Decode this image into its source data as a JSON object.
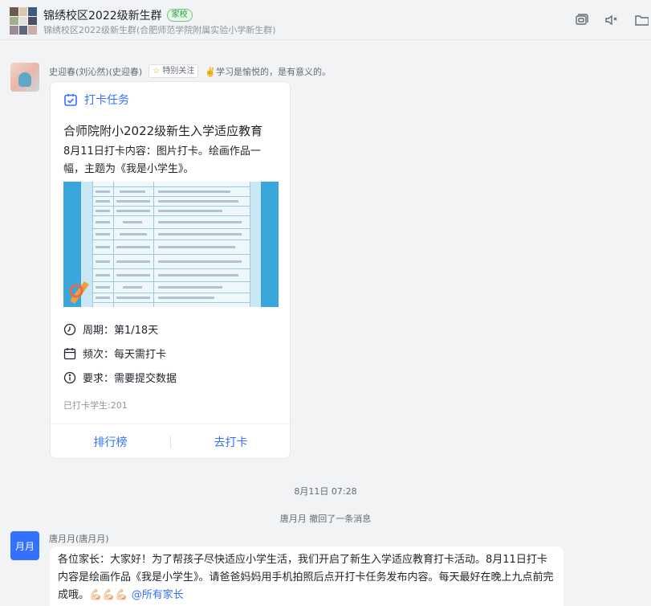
{
  "header": {
    "title": "锦绣校区2022级新生群",
    "badge": "家校",
    "subtitle": "锦绣校区2022级新生群(合肥师范学院附属实验小学新生群)",
    "icons": [
      "video-call-icon",
      "speaker-icon",
      "folder-icon"
    ]
  },
  "message1": {
    "sender": "史迎春(刘沁然)(史迎春)",
    "tag": "特别关注",
    "signature": "✌️学习是愉悦的，是有意义的。",
    "card": {
      "type_label": "打卡任务",
      "title": "合师院附小2022级新生入学适应教育",
      "content": "8月11日打卡内容：图片打卡。绘画作品一幅，主题为《我是小学生》。",
      "period": "周期：第1/18天",
      "frequency": "频次：每天需打卡",
      "requirement": "要求：需要提交数据",
      "done_count": "已打卡学生:201",
      "btn_rank": "排行榜",
      "btn_checkin": "去打卡"
    }
  },
  "timestamp": "8月11日 07:28",
  "revoke_notice": "唐月月 撤回了一条消息",
  "message2": {
    "avatar_text": "月月",
    "sender": "唐月月(唐月月)",
    "text": "各位家长：大家好！为了帮孩子尽快适应小学生活，我们开启了新生入学适应教育打卡活动。8月11日打卡内容是绘画作品《我是小学生》。请爸爸妈妈用手机拍照后点开打卡任务发布内容。每天最好在晚上九点前完成哦。",
    "emojis": "💪🏻💪🏻💪🏻",
    "mention": "@所有家长"
  },
  "colors": {
    "accent": "#3370ff",
    "badge_green": "#1a9c3a"
  }
}
